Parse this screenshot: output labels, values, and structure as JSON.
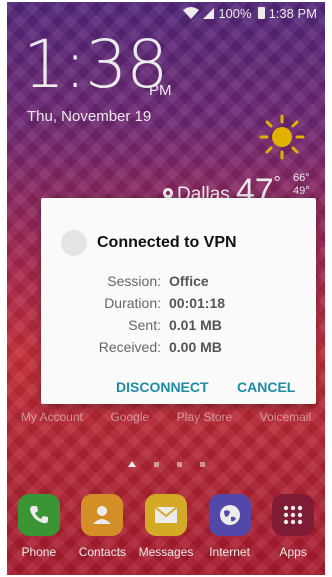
{
  "status_bar": {
    "battery": "100%",
    "time": "1:38 PM"
  },
  "lockscreen": {
    "clock": "1:38",
    "ampm": "PM",
    "date": "Thu, November 19",
    "city": "Dallas",
    "temperature": "47",
    "degree": "°",
    "high": "66°",
    "low": "49°"
  },
  "app_labels": [
    "My Account",
    "Google",
    "Play Store",
    "Voicemail"
  ],
  "dock": [
    {
      "label": "Phone",
      "icon": "phone-icon",
      "color": "#3fa33a"
    },
    {
      "label": "Contacts",
      "icon": "contacts-icon",
      "color": "#e79b2a"
    },
    {
      "label": "Messages",
      "icon": "messages-icon",
      "color": "#e7b82a"
    },
    {
      "label": "Internet",
      "icon": "internet-icon",
      "color": "#5a4fb8"
    },
    {
      "label": "Apps",
      "icon": "apps-grid-icon",
      "color": "#8a1e3a"
    }
  ],
  "dialog": {
    "title": "Connected to VPN",
    "rows": [
      {
        "key": "Session:",
        "value": "Office"
      },
      {
        "key": "Duration:",
        "value": "00:01:18"
      },
      {
        "key": "Sent:",
        "value": "0.01 MB"
      },
      {
        "key": "Received:",
        "value": "0.00 MB"
      }
    ],
    "disconnect_label": "DISCONNECT",
    "cancel_label": "CANCEL",
    "accent": "#1f8ca6"
  }
}
